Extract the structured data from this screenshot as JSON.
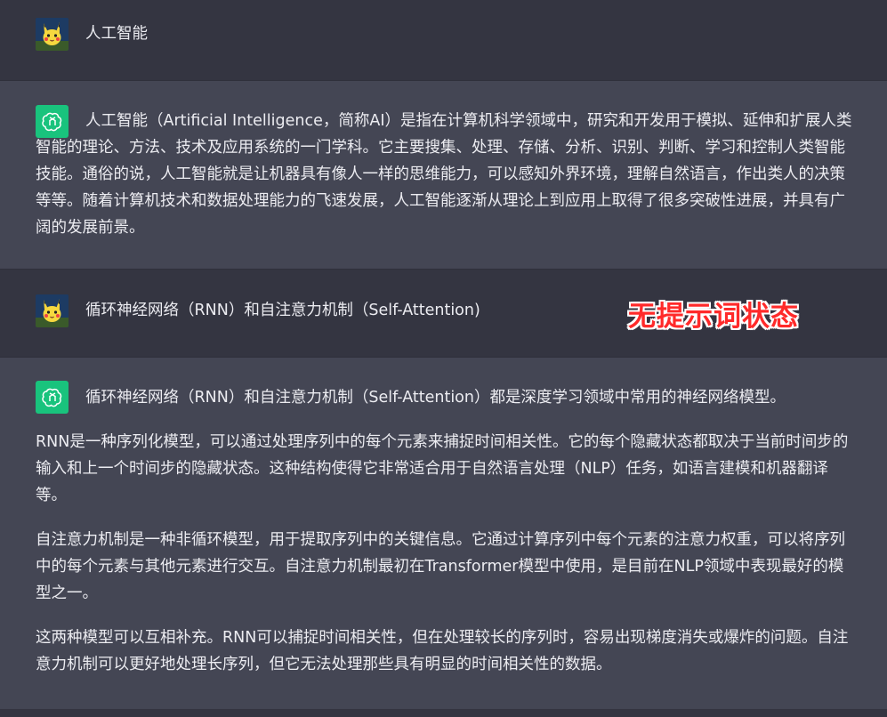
{
  "colors": {
    "user_row_bg": "#343541",
    "assistant_row_bg": "#444654",
    "assistant_avatar_bg": "#19c37d",
    "stamp_text": "#ff2a2a"
  },
  "conversation": [
    {
      "role": "user",
      "avatar_icon": "pikachu-avatar-icon",
      "text": "人工智能"
    },
    {
      "role": "assistant",
      "avatar_icon": "openai-logo-icon",
      "paragraphs": [
        "人工智能（Artificial Intelligence，简称AI）是指在计算机科学领域中，研究和开发用于模拟、延伸和扩展人类智能的理论、方法、技术及应用系统的一门学科。它主要搜集、处理、存储、分析、识别、判断、学习和控制人类智能技能。通俗的说，人工智能就是让机器具有像人一样的思维能力，可以感知外界环境，理解自然语言，作出类人的决策等等。随着计算机技术和数据处理能力的飞速发展，人工智能逐渐从理论上到应用上取得了很多突破性进展，并具有广阔的发展前景。"
      ]
    },
    {
      "role": "user",
      "avatar_icon": "pikachu-avatar-icon",
      "text": "循环神经网络（RNN）和自注意力机制（Self-Attention)"
    },
    {
      "role": "assistant",
      "avatar_icon": "openai-logo-icon",
      "paragraphs": [
        "循环神经网络（RNN）和自注意力机制（Self-Attention）都是深度学习领域中常用的神经网络模型。",
        "RNN是一种序列化模型，可以通过处理序列中的每个元素来捕捉时间相关性。它的每个隐藏状态都取决于当前时间步的输入和上一个时间步的隐藏状态。这种结构使得它非常适合用于自然语言处理（NLP）任务，如语言建模和机器翻译等。",
        "自注意力机制是一种非循环模型，用于提取序列中的关键信息。它通过计算序列中每个元素的注意力权重，可以将序列中的每个元素与其他元素进行交互。自注意力机制最初在Transformer模型中使用，是目前在NLP领域中表现最好的模型之一。",
        "这两种模型可以互相补充。RNN可以捕捉时间相关性，但在处理较长的序列时，容易出现梯度消失或爆炸的问题。自注意力机制可以更好地处理长序列，但它无法处理那些具有明显的时间相关性的数据。"
      ]
    }
  ],
  "overlay_stamp": "无提示词状态"
}
